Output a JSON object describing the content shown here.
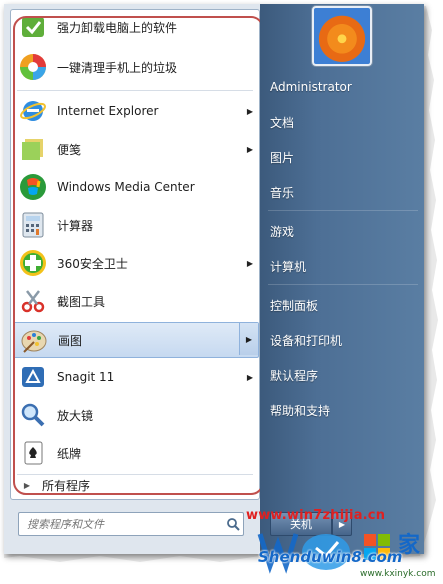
{
  "left_items": [
    {
      "label": "强力卸载电脑上的软件",
      "icon": "uninstall-icon",
      "arrow": false
    },
    {
      "label": "一键清理手机上的垃圾",
      "icon": "phone-clean-icon",
      "arrow": false
    },
    {
      "label": "Internet Explorer",
      "icon": "internet-explorer-icon",
      "arrow": true
    },
    {
      "label": "便笺",
      "icon": "sticky-notes-icon",
      "arrow": true
    },
    {
      "label": "Windows Media Center",
      "icon": "media-center-icon",
      "arrow": false
    },
    {
      "label": "计算器",
      "icon": "calculator-icon",
      "arrow": false
    },
    {
      "label": "360安全卫士",
      "icon": "360-guard-icon",
      "arrow": true
    },
    {
      "label": "截图工具",
      "icon": "snipping-tool-icon",
      "arrow": false
    },
    {
      "label": "画图",
      "icon": "paint-icon",
      "arrow": true
    },
    {
      "label": "Snagit 11",
      "icon": "snagit-icon",
      "arrow": true
    },
    {
      "label": "放大镜",
      "icon": "magnifier-icon",
      "arrow": false
    },
    {
      "label": "纸牌",
      "icon": "solitaire-icon",
      "arrow": false
    }
  ],
  "all_programs_label": "所有程序",
  "search_placeholder": "搜索程序和文件",
  "right_items": [
    {
      "label": "Administrator"
    },
    {
      "label": "文档"
    },
    {
      "label": "图片"
    },
    {
      "label": "音乐"
    },
    {
      "label": "游戏"
    },
    {
      "label": "计算机"
    },
    {
      "label": "控制面板"
    },
    {
      "label": "设备和打印机"
    },
    {
      "label": "默认程序"
    },
    {
      "label": "帮助和支持"
    }
  ],
  "shutdown_label": "关机",
  "watermarks": {
    "top": "www.win7zhijia.cn",
    "logo": "Shenduwin8.com",
    "bottom": "www.kxinyk.com"
  },
  "colors": {
    "highlight_outline": "#c0504d",
    "right_panel": "#4d6f95",
    "watermark_red": "#e02020",
    "watermark_blue": "#1468c8"
  }
}
